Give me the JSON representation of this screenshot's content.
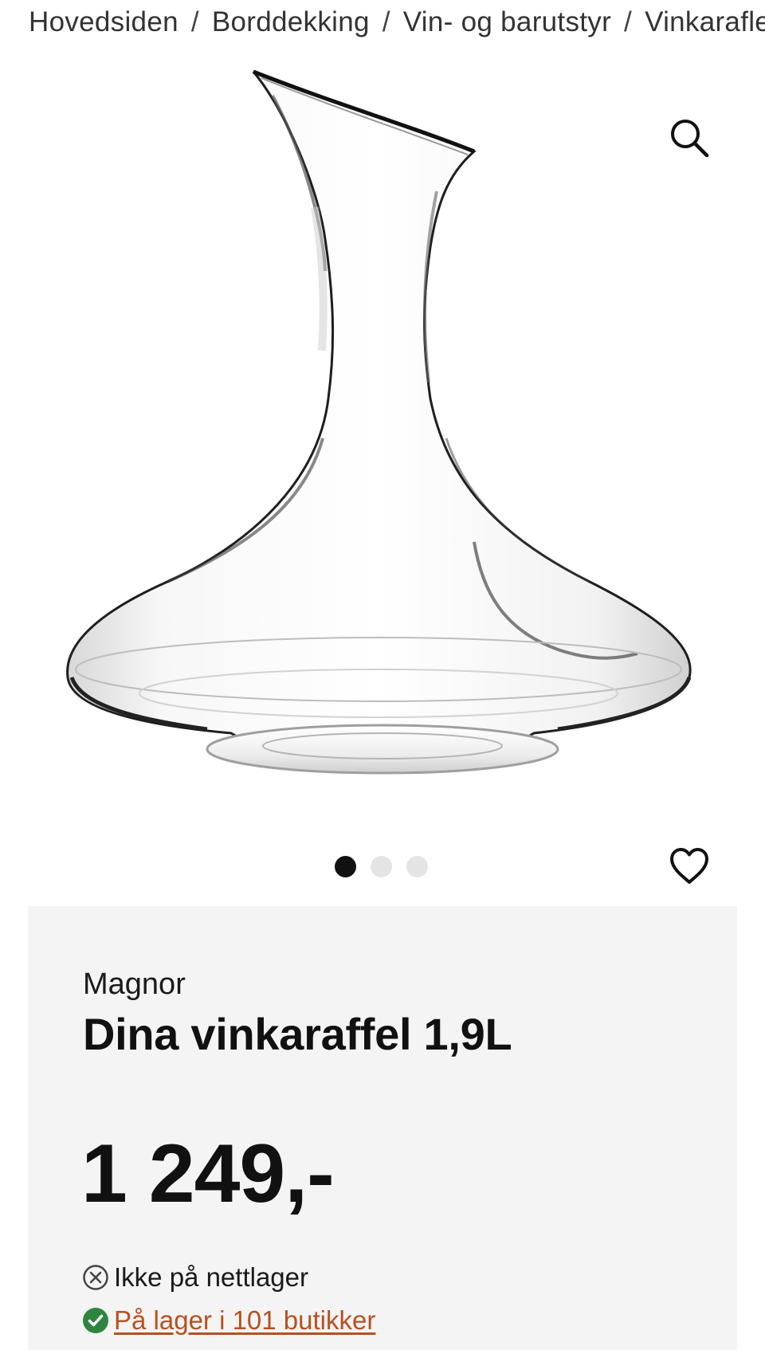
{
  "breadcrumb": {
    "items": [
      {
        "label": "Hovedsiden"
      },
      {
        "label": "Borddekking"
      },
      {
        "label": "Vin- og barutstyr"
      },
      {
        "label": "Vinkarafler"
      }
    ],
    "separator": "/"
  },
  "gallery": {
    "image_subject": "glass wine decanter",
    "zoom_icon": "search-icon",
    "slide_count": 3,
    "active_slide": 1,
    "favorite_icon": "heart-icon"
  },
  "product": {
    "brand": "Magnor",
    "title": "Dina vinkaraffel 1,9L",
    "price": "1 249,-"
  },
  "availability": {
    "online": {
      "icon": "x-circle-icon",
      "label": "Ikke på nettlager"
    },
    "stores": {
      "icon": "check-circle-icon",
      "label": " På lager i 101 butikker"
    }
  },
  "colors": {
    "panel_background": "#f4f4f4",
    "in_stock_green": "#2e8540",
    "store_link": "#b8501f",
    "active_dot": "#111111",
    "inactive_dot": "#e4e4e4"
  }
}
